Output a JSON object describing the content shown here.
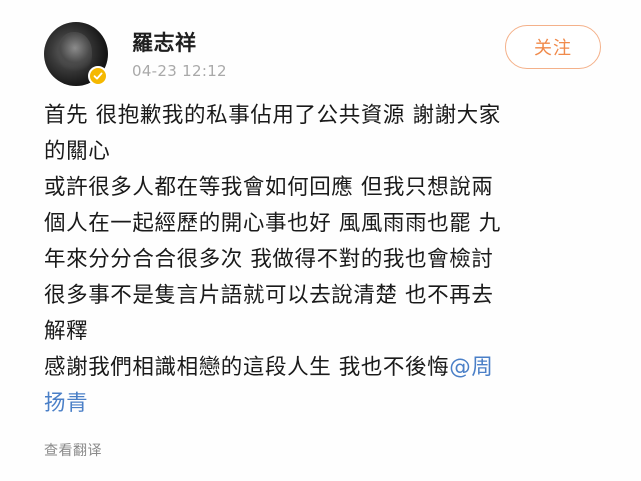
{
  "post": {
    "author": {
      "name": "羅志祥",
      "verified_icon": "verified-badge-icon",
      "verified_color": "#f5b800"
    },
    "timestamp": "04-23 12:12",
    "follow_label": "关注",
    "follow_color": "#f08a4b",
    "content_lines": [
      "首先 很抱歉我的私事佔用了公共資源 謝謝大家",
      "的關心",
      "或許很多人都在等我會如何回應 但我只想說兩",
      "個人在一起經歷的開心事也好 風風雨雨也罷 九",
      "年來分分合合很多次 我做得不對的我也會檢討",
      "很多事不是隻言片語就可以去說清楚 也不再去",
      "解釋",
      "感謝我們相識相戀的這段人生 我也不後悔"
    ],
    "mention_part1": "@周",
    "mention_part2": "扬青",
    "mention_color": "#4a7fc7",
    "translate_label": "查看翻译"
  }
}
